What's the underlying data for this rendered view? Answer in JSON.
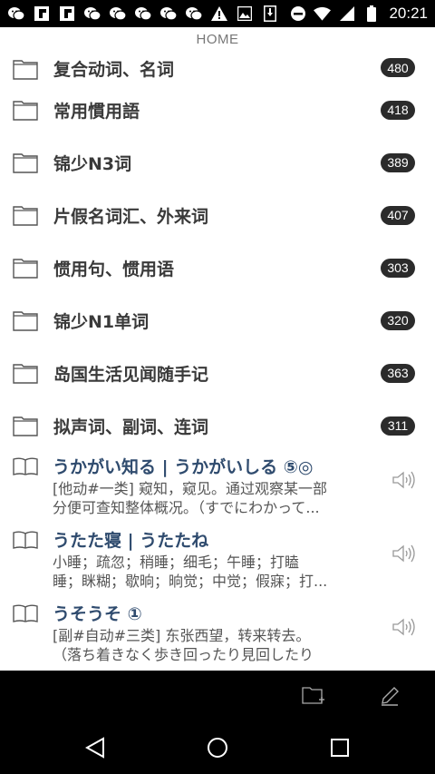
{
  "status_bar": {
    "time": "20:21",
    "left_icons": [
      "wechat-icon",
      "flipboard-icon",
      "flipboard-icon",
      "wechat-icon",
      "wechat-icon",
      "wechat-icon",
      "wechat-icon",
      "wechat-icon",
      "warning-icon",
      "image-icon",
      "download-icon"
    ],
    "right_icons": [
      "do-not-disturb-icon",
      "wifi-icon",
      "signal-icon",
      "battery-icon"
    ]
  },
  "header": {
    "title": "HOME"
  },
  "folders": [
    {
      "label": "复合动词、名词",
      "count": "480"
    },
    {
      "label": "常用慣用語",
      "count": "418"
    },
    {
      "label": "锦少N3词",
      "count": "389"
    },
    {
      "label": "片假名词汇、外来词",
      "count": "407"
    },
    {
      "label": "惯用句、惯用语",
      "count": "303"
    },
    {
      "label": "锦少N1单词",
      "count": "320"
    },
    {
      "label": "岛国生活见闻随手记",
      "count": "363"
    },
    {
      "label": "拟声词、副词、连词",
      "count": "311"
    }
  ],
  "words": [
    {
      "head": "うかがい知る | うかがいしる ⑤◎",
      "def_line1": "[他动#一类] 窥知，窥见。通过观察某一部",
      "def_line2": "分便可查知整体概况。（すでにわかって..."
    },
    {
      "head": "うたた寝 | うたたね",
      "def_line1": "小睡；疏忽；稍睡；细毛；午睡；打瞌",
      "def_line2": "睡；眯糊；歇晌；晌觉；中觉；假寐；打..."
    },
    {
      "head": "うそうそ ①",
      "def_line1": "[副#自动#三类] 东张西望，转来转去。",
      "def_line2": "（落ち着きなく歩き回ったり見回したり"
    }
  ],
  "colors": {
    "badge": "#2b2b2b",
    "word_head": "#2f4b6e",
    "bars": "#000000"
  }
}
